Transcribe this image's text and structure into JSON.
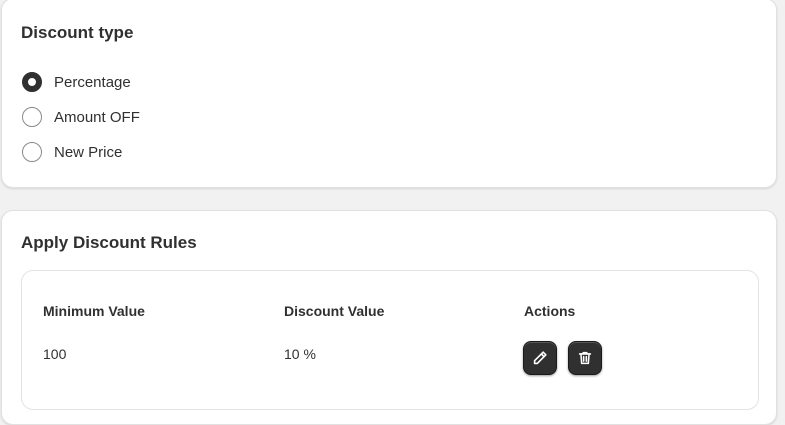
{
  "discount_type": {
    "title": "Discount type",
    "options": [
      {
        "label": "Percentage",
        "selected": true
      },
      {
        "label": "Amount OFF",
        "selected": false
      },
      {
        "label": "New Price",
        "selected": false
      }
    ]
  },
  "rules": {
    "title": "Apply Discount Rules",
    "columns": [
      "Minimum Value",
      "Discount Value",
      "Actions"
    ],
    "rows": [
      {
        "minimum_value": "100",
        "discount_value": "10 %"
      }
    ],
    "actions": {
      "edit_icon": "pencil-icon",
      "delete_icon": "trash-icon"
    }
  },
  "colors": {
    "background": "#f1f1f1",
    "card": "#ffffff",
    "text": "#303030",
    "button": "#303030"
  }
}
